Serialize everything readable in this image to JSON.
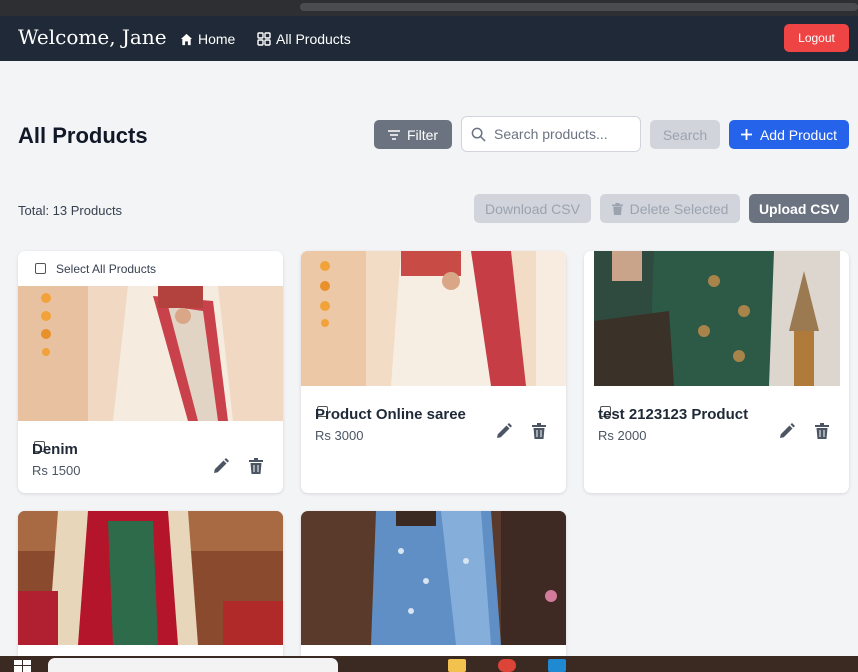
{
  "nav": {
    "welcome": "Welcome, Jane",
    "home_label": "Home",
    "all_products_label": "All Products",
    "logout_label": "Logout"
  },
  "page": {
    "title": "All Products",
    "filter_label": "Filter",
    "search_placeholder": "Search products...",
    "search_label": "Search",
    "add_label": "Add Product",
    "total_text": "Total: 13 Products",
    "download_csv_label": "Download CSV",
    "delete_selected_label": "Delete Selected",
    "upload_csv_label": "Upload CSV",
    "select_all_label": "Select All Products"
  },
  "products": [
    {
      "name": "Denim",
      "price": "Rs 1500"
    },
    {
      "name": "Product Online saree",
      "price": "Rs 3000"
    },
    {
      "name": "test 2123123 Product",
      "price": "Rs 2000"
    },
    {
      "name": "",
      "price": ""
    },
    {
      "name": "",
      "price": ""
    }
  ],
  "colors": {
    "navbar": "#1f2937",
    "logout": "#ef4444",
    "primary": "#2563eb",
    "secondary": "#6b7280",
    "disabled": "#d1d5db"
  },
  "icons": [
    "home-icon",
    "grid-icon",
    "filter-icon",
    "search-icon",
    "plus-icon",
    "trash-icon",
    "edit-icon"
  ]
}
